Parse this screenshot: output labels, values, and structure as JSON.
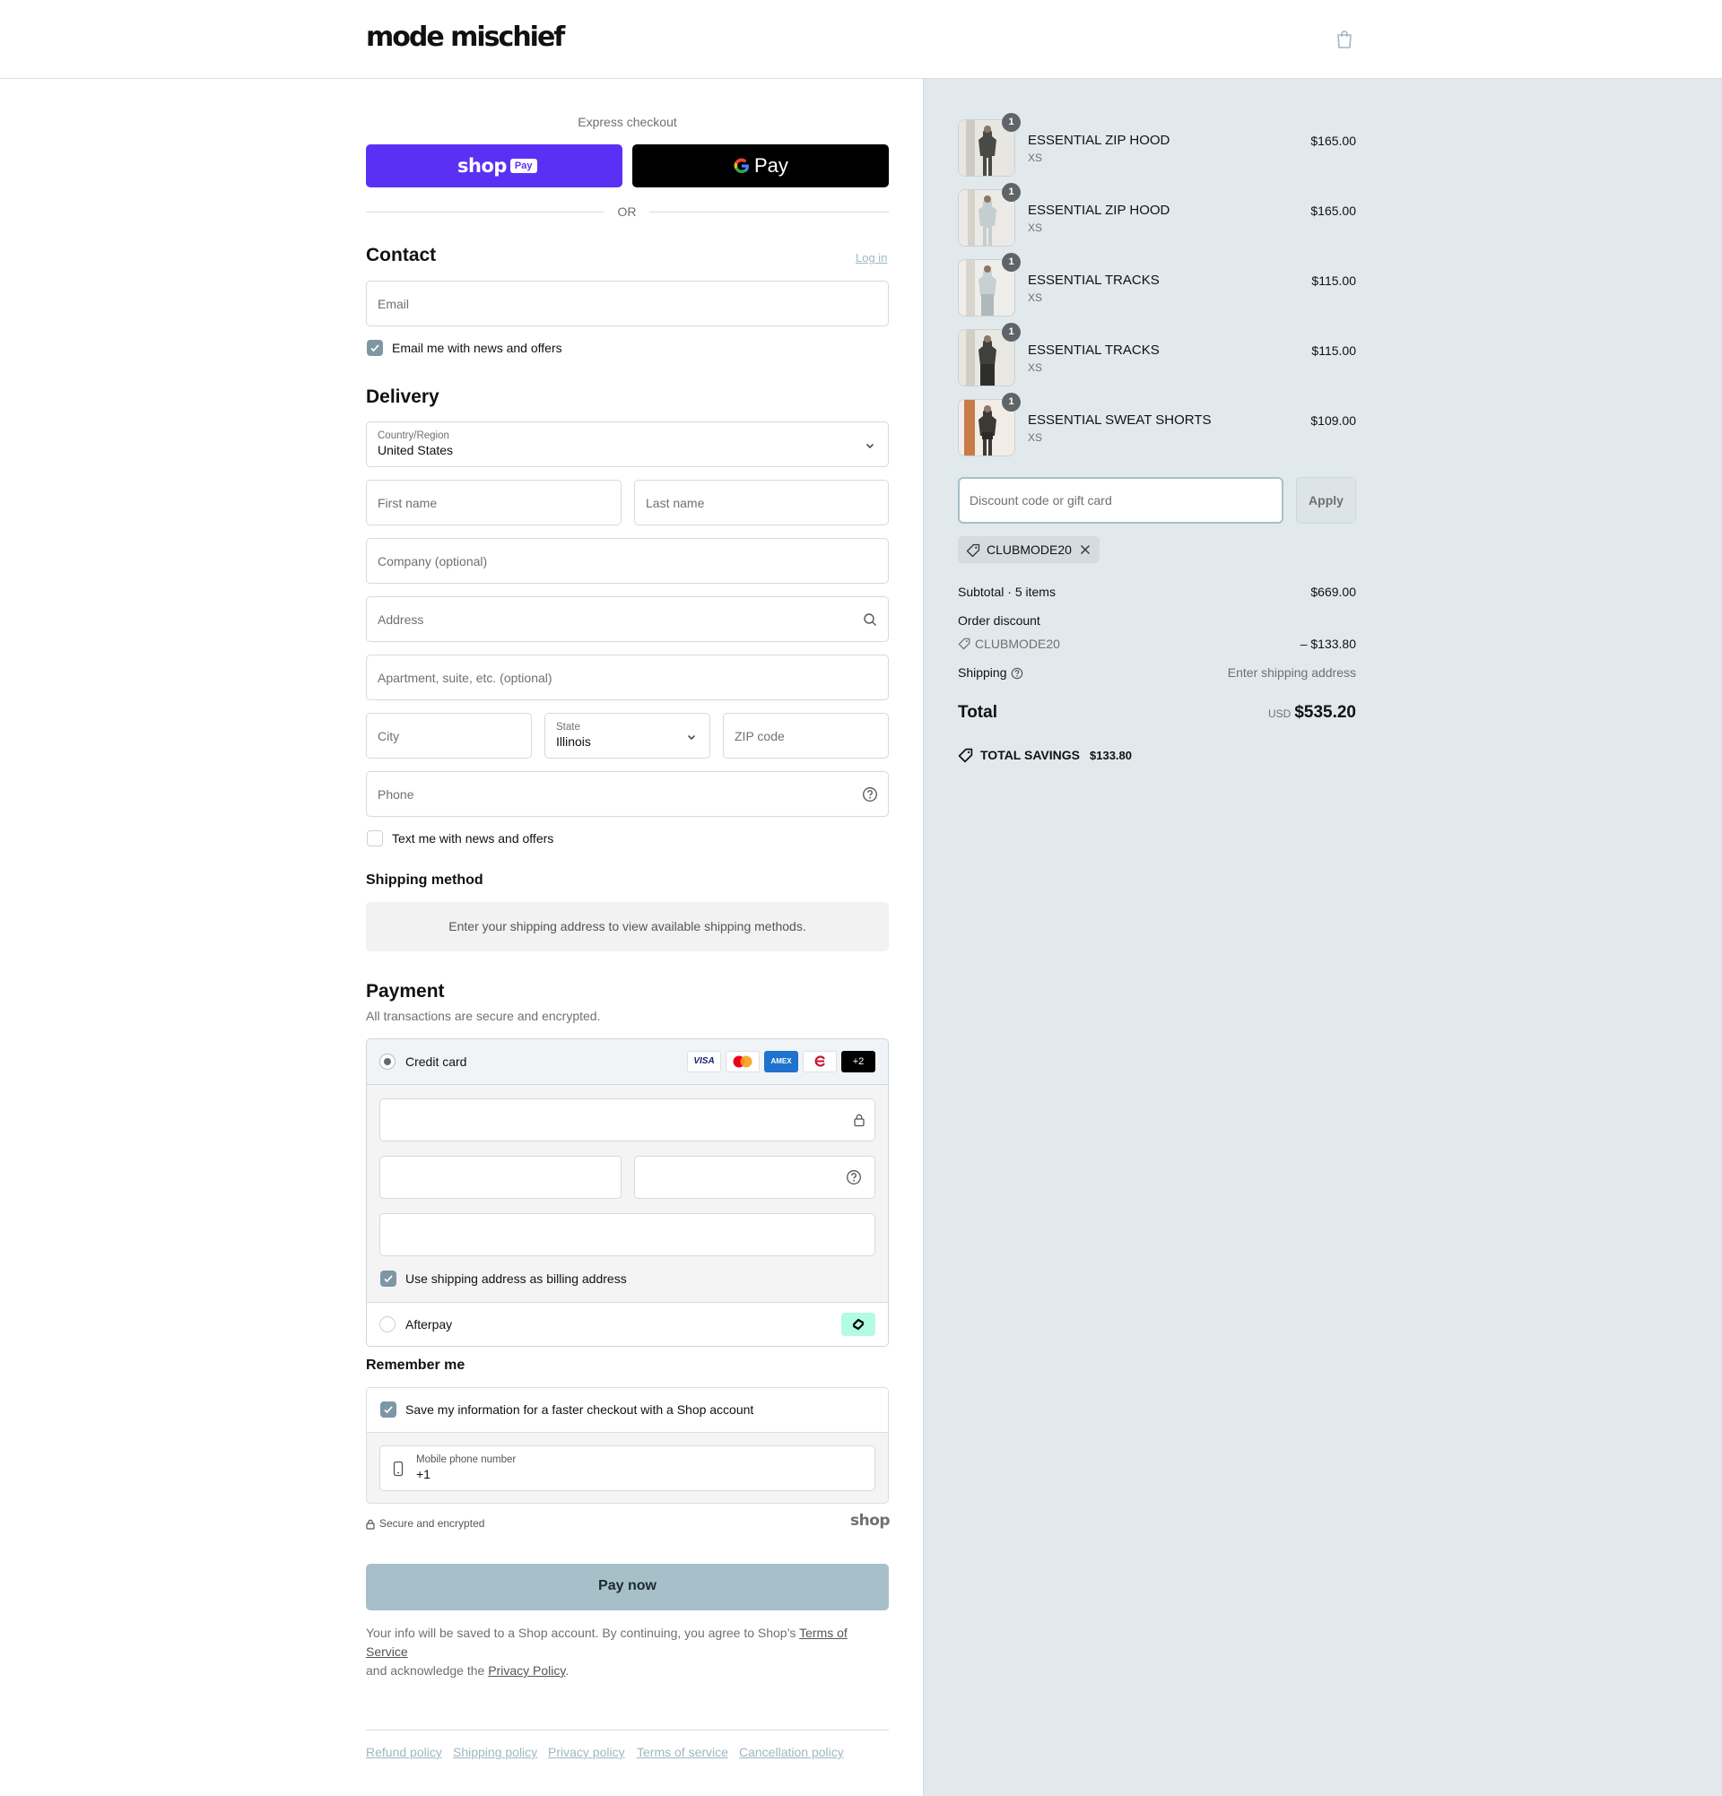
{
  "brand": {
    "name": "mode mischief"
  },
  "express": {
    "label": "Express checkout",
    "shop_pay": "shop",
    "shop_pay_badge": "Pay",
    "gpay": "Pay",
    "divider": "OR"
  },
  "contact": {
    "title": "Contact",
    "login": "Log in",
    "email_placeholder": "Email",
    "news_label": "Email me with news and offers"
  },
  "delivery": {
    "title": "Delivery",
    "country_label": "Country/Region",
    "country_value": "United States",
    "first_name": "First name",
    "last_name": "Last name",
    "company": "Company (optional)",
    "address": "Address",
    "apartment": "Apartment, suite, etc. (optional)",
    "city": "City",
    "state_label": "State",
    "state_value": "Illinois",
    "zip": "ZIP code",
    "phone": "Phone",
    "text_label": "Text me with news and offers"
  },
  "shipping_method": {
    "title": "Shipping method",
    "message": "Enter your shipping address to view available shipping methods."
  },
  "payment": {
    "title": "Payment",
    "subtitle": "All transactions are secure and encrypted.",
    "credit_card": "Credit card",
    "more_cards": "+2",
    "billing_label": "Use shipping address as billing address",
    "afterpay": "Afterpay"
  },
  "remember": {
    "title": "Remember me",
    "save_label": "Save my information for a faster checkout with a Shop account",
    "mobile_label": "Mobile phone number",
    "mobile_value": "+1",
    "secure": "Secure and encrypted",
    "shop_logo": "shop"
  },
  "pay_now": "Pay now",
  "legal": {
    "line1": "Your info will be saved to a Shop account. By continuing, you agree to Shop’s ",
    "tos": "Terms of Service",
    "line2": "and acknowledge the ",
    "privacy": "Privacy Policy",
    "period": "."
  },
  "footer_links": [
    "Refund policy",
    "Shipping policy",
    "Privacy policy",
    "Terms of service",
    "Cancellation policy"
  ],
  "cart": {
    "items": [
      {
        "name": "ESSENTIAL ZIP HOOD",
        "variant": "XS",
        "price": "$165.00",
        "qty": "1"
      },
      {
        "name": "ESSENTIAL ZIP HOOD",
        "variant": "XS",
        "price": "$165.00",
        "qty": "1"
      },
      {
        "name": "ESSENTIAL TRACKS",
        "variant": "XS",
        "price": "$115.00",
        "qty": "1"
      },
      {
        "name": "ESSENTIAL TRACKS",
        "variant": "XS",
        "price": "$115.00",
        "qty": "1"
      },
      {
        "name": "ESSENTIAL SWEAT SHORTS",
        "variant": "XS",
        "price": "$109.00",
        "qty": "1"
      }
    ],
    "discount_placeholder": "Discount code or gift card",
    "apply": "Apply",
    "code": "CLUBMODE20",
    "subtotal_label": "Subtotal · 5 items",
    "subtotal_value": "$669.00",
    "order_discount_label": "Order discount",
    "discount_code": "CLUBMODE20",
    "discount_value": "– $133.80",
    "shipping_label": "Shipping",
    "shipping_value": "Enter shipping address",
    "total_label": "Total",
    "currency": "USD",
    "total_value": "$535.20",
    "savings_label": "TOTAL SAVINGS",
    "savings_value": "$133.80"
  },
  "colors": {
    "shop_pay": "#5a31f4",
    "pay_button": "#a7bfc9",
    "summary_bg": "#e1e9ec",
    "accent_check": "#7d97a3"
  }
}
